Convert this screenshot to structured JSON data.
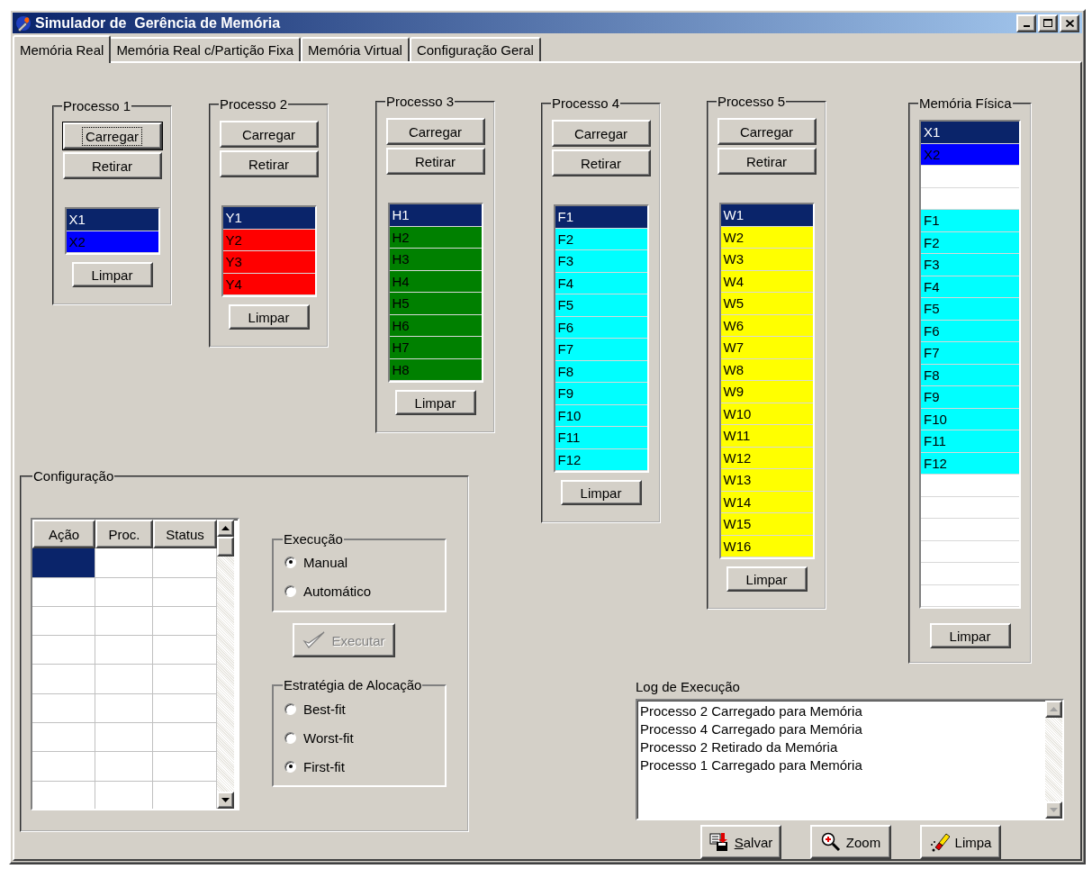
{
  "window": {
    "title": "Simulador de  Gerência de Memória"
  },
  "tabs": [
    {
      "label": "Memória Real",
      "selected": true
    },
    {
      "label": "Memória Real c/Partição Fixa",
      "selected": false
    },
    {
      "label": "Memória Virtual",
      "selected": false
    },
    {
      "label": "Configuração Geral",
      "selected": false
    }
  ],
  "processes": [
    {
      "title": "Processo 1",
      "load": {
        "label": "Carregar",
        "focused": true
      },
      "remove": "Retirar",
      "clear": "Limpar",
      "cells": [
        {
          "label": "X1",
          "selected": true
        },
        {
          "label": "X2",
          "selected": false,
          "color": "#0000ff"
        }
      ]
    },
    {
      "title": "Processo 2",
      "load": {
        "label": "Carregar",
        "focused": false
      },
      "remove": "Retirar",
      "clear": "Limpar",
      "cells": [
        {
          "label": "Y1",
          "selected": true
        },
        {
          "label": "Y2",
          "selected": false,
          "color": "#ff0000"
        },
        {
          "label": "Y3",
          "selected": false,
          "color": "#ff0000"
        },
        {
          "label": "Y4",
          "selected": false,
          "color": "#ff0000"
        }
      ]
    },
    {
      "title": "Processo 3",
      "load": {
        "label": "Carregar",
        "focused": false
      },
      "remove": "Retirar",
      "clear": "Limpar",
      "cells": [
        {
          "label": "H1",
          "selected": true
        },
        {
          "label": "H2",
          "selected": false,
          "color": "#008000"
        },
        {
          "label": "H3",
          "selected": false,
          "color": "#008000"
        },
        {
          "label": "H4",
          "selected": false,
          "color": "#008000"
        },
        {
          "label": "H5",
          "selected": false,
          "color": "#008000"
        },
        {
          "label": "H6",
          "selected": false,
          "color": "#008000"
        },
        {
          "label": "H7",
          "selected": false,
          "color": "#008000"
        },
        {
          "label": "H8",
          "selected": false,
          "color": "#008000"
        }
      ]
    },
    {
      "title": "Processo 4",
      "load": {
        "label": "Carregar",
        "focused": false
      },
      "remove": "Retirar",
      "clear": "Limpar",
      "cells": [
        {
          "label": "F1",
          "selected": true
        },
        {
          "label": "F2",
          "selected": false,
          "color": "#00ffff"
        },
        {
          "label": "F3",
          "selected": false,
          "color": "#00ffff"
        },
        {
          "label": "F4",
          "selected": false,
          "color": "#00ffff"
        },
        {
          "label": "F5",
          "selected": false,
          "color": "#00ffff"
        },
        {
          "label": "F6",
          "selected": false,
          "color": "#00ffff"
        },
        {
          "label": "F7",
          "selected": false,
          "color": "#00ffff"
        },
        {
          "label": "F8",
          "selected": false,
          "color": "#00ffff"
        },
        {
          "label": "F9",
          "selected": false,
          "color": "#00ffff"
        },
        {
          "label": "F10",
          "selected": false,
          "color": "#00ffff"
        },
        {
          "label": "F11",
          "selected": false,
          "color": "#00ffff"
        },
        {
          "label": "F12",
          "selected": false,
          "color": "#00ffff"
        }
      ]
    },
    {
      "title": "Processo 5",
      "load": {
        "label": "Carregar",
        "focused": false
      },
      "remove": "Retirar",
      "clear": "Limpar",
      "cells": [
        {
          "label": "W1",
          "selected": true
        },
        {
          "label": "W2",
          "selected": false,
          "color": "#ffff00"
        },
        {
          "label": "W3",
          "selected": false,
          "color": "#ffff00"
        },
        {
          "label": "W4",
          "selected": false,
          "color": "#ffff00"
        },
        {
          "label": "W5",
          "selected": false,
          "color": "#ffff00"
        },
        {
          "label": "W6",
          "selected": false,
          "color": "#ffff00"
        },
        {
          "label": "W7",
          "selected": false,
          "color": "#ffff00"
        },
        {
          "label": "W8",
          "selected": false,
          "color": "#ffff00"
        },
        {
          "label": "W9",
          "selected": false,
          "color": "#ffff00"
        },
        {
          "label": "W10",
          "selected": false,
          "color": "#ffff00"
        },
        {
          "label": "W11",
          "selected": false,
          "color": "#ffff00"
        },
        {
          "label": "W12",
          "selected": false,
          "color": "#ffff00"
        },
        {
          "label": "W13",
          "selected": false,
          "color": "#ffff00"
        },
        {
          "label": "W14",
          "selected": false,
          "color": "#ffff00"
        },
        {
          "label": "W15",
          "selected": false,
          "color": "#ffff00"
        },
        {
          "label": "W16",
          "selected": false,
          "color": "#ffff00"
        }
      ]
    }
  ],
  "physical_memory": {
    "title": "Memória Física",
    "clear": "Limpar",
    "cells": [
      {
        "label": "X1",
        "selected": true
      },
      {
        "label": "X2",
        "selected": false,
        "color": "#0000ff"
      },
      {
        "selected": false,
        "color": "#ffffff"
      },
      {
        "selected": false,
        "color": "#ffffff"
      },
      {
        "label": "F1",
        "selected": false,
        "color": "#00ffff"
      },
      {
        "label": "F2",
        "selected": false,
        "color": "#00ffff"
      },
      {
        "label": "F3",
        "selected": false,
        "color": "#00ffff"
      },
      {
        "label": "F4",
        "selected": false,
        "color": "#00ffff"
      },
      {
        "label": "F5",
        "selected": false,
        "color": "#00ffff"
      },
      {
        "label": "F6",
        "selected": false,
        "color": "#00ffff"
      },
      {
        "label": "F7",
        "selected": false,
        "color": "#00ffff"
      },
      {
        "label": "F8",
        "selected": false,
        "color": "#00ffff"
      },
      {
        "label": "F9",
        "selected": false,
        "color": "#00ffff"
      },
      {
        "label": "F10",
        "selected": false,
        "color": "#00ffff"
      },
      {
        "label": "F11",
        "selected": false,
        "color": "#00ffff"
      },
      {
        "label": "F12",
        "selected": false,
        "color": "#00ffff"
      },
      {
        "selected": false,
        "color": "#ffffff"
      },
      {
        "selected": false,
        "color": "#ffffff"
      },
      {
        "selected": false,
        "color": "#ffffff"
      },
      {
        "selected": false,
        "color": "#ffffff"
      },
      {
        "selected": false,
        "color": "#ffffff"
      },
      {
        "selected": false,
        "color": "#ffffff"
      }
    ]
  },
  "configuration": {
    "title": "Configuração",
    "table": {
      "columns": [
        "Ação",
        "Proc.",
        "Status"
      ],
      "rows": [
        {
          "selected": true
        },
        {
          "selected": false
        },
        {
          "selected": false
        },
        {
          "selected": false
        },
        {
          "selected": false
        },
        {
          "selected": false
        },
        {
          "selected": false
        },
        {
          "selected": false
        },
        {
          "selected": false
        }
      ]
    },
    "execution": {
      "title": "Execução",
      "options": [
        {
          "label": "Manual",
          "selected": true
        },
        {
          "label": "Automático",
          "selected": false
        }
      ]
    },
    "execute_button": {
      "label": "Executar",
      "disabled": true
    },
    "strategy": {
      "title": "Estratégia de Alocação",
      "options": [
        {
          "label": "Best-fit",
          "selected": false
        },
        {
          "label": "Worst-fit",
          "selected": false
        },
        {
          "label": "First-fit",
          "selected": true
        }
      ]
    }
  },
  "log": {
    "title": "Log de Execução",
    "lines": [
      "Processo 2 Carregado para Memória",
      "Processo 4 Carregado para Memória",
      "Processo 2 Retirado da Memória",
      "Processo 1 Carregado para Memória"
    ]
  },
  "log_buttons": [
    {
      "kind": "save",
      "label": "Salvar",
      "underline_first": true
    },
    {
      "kind": "zoom",
      "label": "Zoom",
      "underline_first": false
    },
    {
      "kind": "clear",
      "label": "Limpa",
      "underline_first": false
    }
  ]
}
